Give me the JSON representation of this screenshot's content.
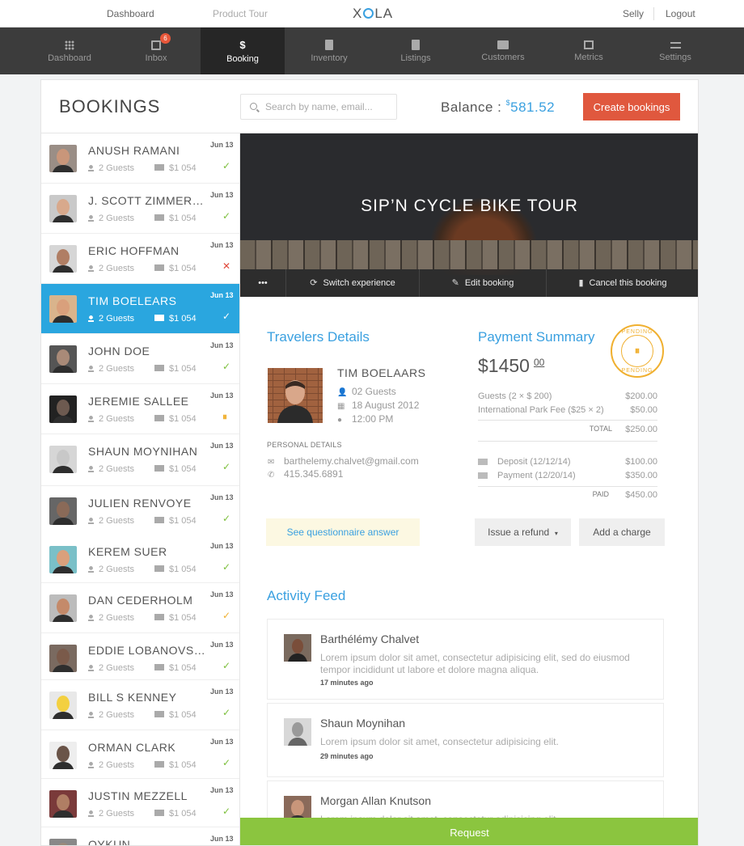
{
  "topbar": {
    "dashboard": "Dashboard",
    "product_tour": "Product Tour",
    "logo_left": "X",
    "logo_right": "LA",
    "user": "Selly",
    "logout": "Logout"
  },
  "nav": {
    "items": [
      {
        "label": "Dashboard",
        "icon": "grid-icon"
      },
      {
        "label": "Inbox",
        "icon": "inbox-icon",
        "badge": "6"
      },
      {
        "label": "Booking",
        "icon": "dollar-icon",
        "glyph": "$"
      },
      {
        "label": "Inventory",
        "icon": "clipboard-icon"
      },
      {
        "label": "Listings",
        "icon": "document-icon"
      },
      {
        "label": "Customers",
        "icon": "id-card-icon"
      },
      {
        "label": "Metrics",
        "icon": "picture-icon"
      },
      {
        "label": "Settings",
        "icon": "sliders-icon"
      }
    ],
    "active": "Booking"
  },
  "header": {
    "title": "BOOKINGS",
    "search_placeholder": "Search by name, email...",
    "balance_label": "Balance : ",
    "balance_currency": "$",
    "balance_amount": "581.52",
    "create_button": "Create bookings"
  },
  "bookings": [
    {
      "name": "ANUSH RAMANI",
      "date": "Jun 13",
      "guests": "2 Guests",
      "price": "$1 054",
      "status": "✓",
      "status_color": "#7cbf3b"
    },
    {
      "name": "J. SCOTT ZIMMERMAN",
      "date": "Jun 13",
      "guests": "2 Guests",
      "price": "$1 054",
      "status": "✓",
      "status_color": "#7cbf3b"
    },
    {
      "name": "ERIC HOFFMAN",
      "date": "Jun 13",
      "guests": "2 Guests",
      "price": "$1 054",
      "status": "✕",
      "status_color": "#e0483a"
    },
    {
      "name": "TIM BOELEARS",
      "date": "Jun 13",
      "guests": "2 Guests",
      "price": "$1 054",
      "status": "✓",
      "status_color": "#ffffff"
    },
    {
      "name": "JOHN DOE",
      "date": "Jun 13",
      "guests": "2 Guests",
      "price": "$1 054",
      "status": "✓",
      "status_color": "#7cbf3b"
    },
    {
      "name": "JEREMIE SALLEE",
      "date": "Jun 13",
      "guests": "2 Guests",
      "price": "$1 054",
      "status": "⏸",
      "status_color": "#f0b030"
    },
    {
      "name": "SHAUN MOYNIHAN",
      "date": "Jun 13",
      "guests": "2 Guests",
      "price": "$1 054",
      "status": "✓",
      "status_color": "#7cbf3b"
    },
    {
      "name": "JULIEN RENVOYE",
      "date": "Jun 13",
      "guests": "2 Guests",
      "price": "$1 054",
      "status": "✓",
      "status_color": "#7cbf3b"
    },
    {
      "name": "KEREM SUER",
      "date": "Jun 13",
      "guests": "2 Guests",
      "price": "$1 054",
      "status": "✓",
      "status_color": "#7cbf3b"
    },
    {
      "name": "DAN CEDERHOLM",
      "date": "Jun 13",
      "guests": "2 Guests",
      "price": "$1 054",
      "status": "✓",
      "status_color": "#f0b030"
    },
    {
      "name": "EDDIE LOBANOVSKIY",
      "date": "Jun 13",
      "guests": "2 Guests",
      "price": "$1 054",
      "status": "✓",
      "status_color": "#7cbf3b"
    },
    {
      "name": "BILL S KENNEY",
      "date": "Jun 13",
      "guests": "2 Guests",
      "price": "$1 054",
      "status": "✓",
      "status_color": "#7cbf3b"
    },
    {
      "name": "ORMAN CLARK",
      "date": "Jun 13",
      "guests": "2 Guests",
      "price": "$1 054",
      "status": "✓",
      "status_color": "#7cbf3b"
    },
    {
      "name": "JUSTIN MEZZELL",
      "date": "Jun 13",
      "guests": "2 Guests",
      "price": "$1 054",
      "status": "✓",
      "status_color": "#7cbf3b"
    },
    {
      "name": "OYKUN",
      "date": "Jun 13",
      "guests": "",
      "price": "",
      "status": "",
      "status_color": "#7cbf3b"
    }
  ],
  "selected_index": 3,
  "experience": {
    "title": "SIP’N CYCLE BIKE TOUR",
    "more": "•••",
    "switch": "Switch experience",
    "edit": "Edit booking",
    "cancel": "Cancel this booking"
  },
  "travelers": {
    "heading": "Travelers Details",
    "name": "TIM BOELAARS",
    "guests": "02 Guests",
    "date": "18 August 2012",
    "time": "12:00 PM",
    "personal_label": "PERSONAL DETAILS",
    "email": "barthelemy.chalvet@gmail.com",
    "phone": "415.345.6891"
  },
  "payment": {
    "heading": "Payment Summary",
    "amount": "$1450",
    "cents": "00",
    "stamp_top": "PENDING",
    "stamp_bottom": "PENDING",
    "stamp_icon": "⏸",
    "lines": [
      {
        "label": "Guests (2 × $ 200)",
        "value": "$200.00"
      },
      {
        "label": "International Park Fee ($25 × 2)",
        "value": "$50.00"
      }
    ],
    "total_label": "TOTAL",
    "total_value": "$250.00",
    "deposit_label": "Deposit (12/12/14)",
    "deposit_value": "$100.00",
    "payment_label": "Payment (12/20/14)",
    "payment_value": "$350.00",
    "paid_label": "PAID",
    "paid_value": "$450.00"
  },
  "actions": {
    "questionnaire": "See questionnaire answer",
    "refund": "Issue a refund",
    "refund_caret": "▾",
    "charge": "Add a charge"
  },
  "activity": {
    "heading": "Activity Feed",
    "items": [
      {
        "name": "Barthélémy Chalvet",
        "text": "Lorem ipsum dolor sit amet, consectetur adipisicing elit, sed do eiusmod tempor incididunt ut labore et dolore magna aliqua.",
        "time": "17 minutes ago"
      },
      {
        "name": "Shaun Moynihan",
        "text": "Lorem ipsum dolor sit amet, consectetur adipisicing elit.",
        "time": "29 minutes ago"
      },
      {
        "name": "Morgan Allan Knutson",
        "text": "Lorem ipsum dolor sit amet, consectetur adipisicing elit.",
        "time": ""
      }
    ]
  },
  "request_button": "Request",
  "colors": {
    "accent": "#3aa0e0",
    "create": "#e0583e",
    "selected": "#2aa6df",
    "request": "#8bc53f",
    "pending": "#f0b030"
  }
}
